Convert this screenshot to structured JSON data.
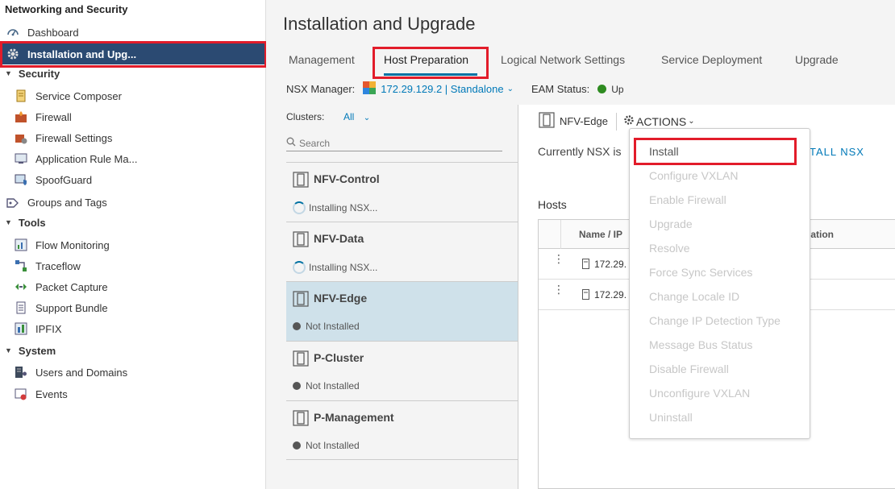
{
  "sidebar": {
    "title": "Networking and Security",
    "items": [
      {
        "label": "Dashboard",
        "icon": "dashboard-icon"
      },
      {
        "label": "Installation and Upg...",
        "icon": "gear-icon",
        "active": true
      },
      {
        "label": "Security",
        "section": true
      },
      {
        "label": "Service Composer",
        "icon": "service-composer-icon"
      },
      {
        "label": "Firewall",
        "icon": "firewall-icon"
      },
      {
        "label": "Firewall Settings",
        "icon": "firewall-settings-icon"
      },
      {
        "label": "Application Rule Ma...",
        "icon": "application-rule-icon"
      },
      {
        "label": "SpoofGuard",
        "icon": "spoofguard-icon"
      },
      {
        "label": "Groups and Tags",
        "icon": "groups-icon"
      },
      {
        "label": "Tools",
        "section": true
      },
      {
        "label": "Flow Monitoring",
        "icon": "flow-monitoring-icon"
      },
      {
        "label": "Traceflow",
        "icon": "traceflow-icon"
      },
      {
        "label": "Packet Capture",
        "icon": "packet-capture-icon"
      },
      {
        "label": "Support Bundle",
        "icon": "support-bundle-icon"
      },
      {
        "label": "IPFIX",
        "icon": "ipfix-icon"
      },
      {
        "label": "System",
        "section": true
      },
      {
        "label": "Users and Domains",
        "icon": "users-icon"
      },
      {
        "label": "Events",
        "icon": "events-icon"
      }
    ]
  },
  "main": {
    "title": "Installation and Upgrade",
    "tabs": [
      "Management",
      "Host Preparation",
      "Logical Network Settings",
      "Service Deployment",
      "Upgrade"
    ],
    "nsx_manager_label": "NSX Manager:",
    "nsx_manager_value": "172.29.129.2 | Standalone",
    "eam_label": "EAM Status:",
    "eam_value": "Up"
  },
  "clusters": {
    "label": "Clusters:",
    "filter": "All",
    "search_placeholder": "Search",
    "items": [
      {
        "name": "NFV-Control",
        "status": "Installing NSX..."
      },
      {
        "name": "NFV-Data",
        "status": "Installing NSX..."
      },
      {
        "name": "NFV-Edge",
        "status": "Not Installed"
      },
      {
        "name": "P-Cluster",
        "status": "Not Installed"
      },
      {
        "name": "P-Management",
        "status": "Not Installed"
      }
    ]
  },
  "detail": {
    "cluster_name": "NFV-Edge",
    "actions_label": "ACTIONS",
    "status_text": "Currently NSX is",
    "install_link": "TALL NSX",
    "hosts_label": "Hosts",
    "col_name": "Name / IP",
    "col_installation": "lation",
    "rows": [
      "172.29.",
      "172.29."
    ]
  },
  "actions_menu": [
    {
      "label": "Install",
      "enabled": true
    },
    {
      "label": "Configure VXLAN",
      "enabled": false
    },
    {
      "label": "Enable Firewall",
      "enabled": false
    },
    {
      "label": "Upgrade",
      "enabled": false
    },
    {
      "label": "Resolve",
      "enabled": false
    },
    {
      "label": "Force Sync Services",
      "enabled": false
    },
    {
      "label": "Change Locale ID",
      "enabled": false
    },
    {
      "label": "Change IP Detection Type",
      "enabled": false
    },
    {
      "label": "Message Bus Status",
      "enabled": false
    },
    {
      "label": "Disable Firewall",
      "enabled": false
    },
    {
      "label": "Unconfigure VXLAN",
      "enabled": false
    },
    {
      "label": "Uninstall",
      "enabled": false
    }
  ],
  "colors": {
    "accent": "#0072a3",
    "active_nav": "#2b4a72",
    "highlight": "#e21c2a",
    "status_up": "#2e8b20"
  }
}
